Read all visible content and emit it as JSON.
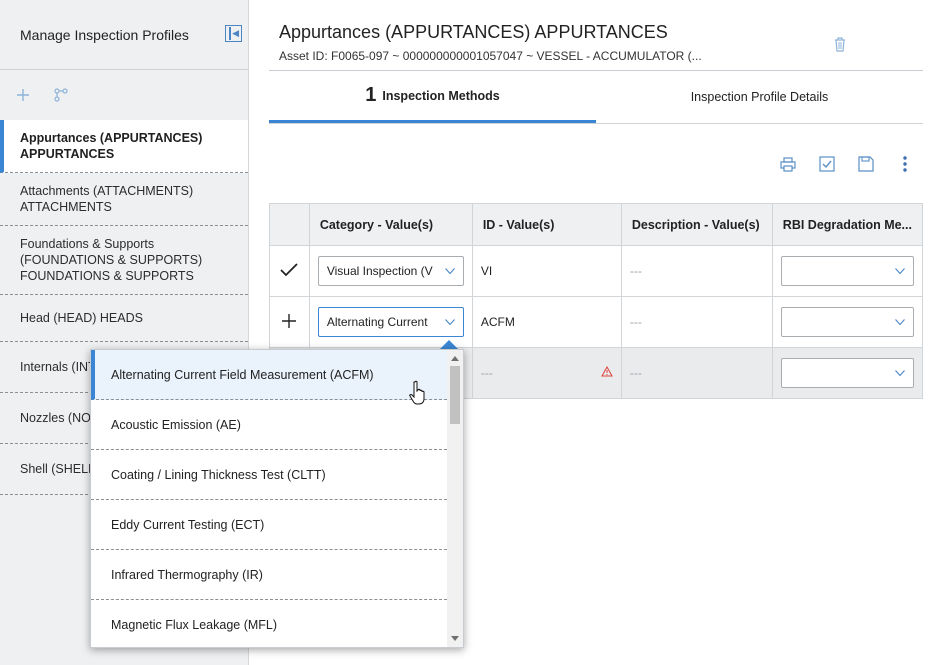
{
  "sidebar": {
    "title": "Manage Inspection Profiles",
    "items": [
      {
        "label": "Appurtances (APPURTANCES) APPURTANCES",
        "active": true
      },
      {
        "label": "Attachments (ATTACHMENTS) ATTACHMENTS"
      },
      {
        "label": "Foundations & Supports (FOUNDATIONS & SUPPORTS) FOUNDATIONS & SUPPORTS"
      },
      {
        "label": "Head (HEAD) HEADS"
      },
      {
        "label": "Internals (INT"
      },
      {
        "label": "Nozzles (NOZ"
      },
      {
        "label": "Shell (SHELL)"
      }
    ]
  },
  "header": {
    "title": "Appurtances (APPURTANCES) APPURTANCES",
    "asset_line": "Asset ID: F0065-097 ~ 000000000001057047 ~ VESSEL - ACCUMULATOR (..."
  },
  "tabs": [
    {
      "count": "1",
      "label": "Inspection Methods"
    },
    {
      "label": "Inspection Profile Details"
    }
  ],
  "grid": {
    "columns": [
      "Category - Value(s)",
      "ID - Value(s)",
      "Description - Value(s)",
      "RBI Degradation Me..."
    ],
    "rows": [
      {
        "category": "Visual Inspection (V",
        "id": "VI",
        "description": "---"
      },
      {
        "category": "Alternating Current",
        "id": "ACFM",
        "description": "---"
      },
      {
        "category": "",
        "id": "---",
        "description": "---"
      }
    ]
  },
  "dropdown": {
    "options": [
      "Alternating Current Field Measurement (ACFM)",
      "Acoustic Emission (AE)",
      "Coating / Lining Thickness Test (CLTT)",
      "Eddy Current Testing (ECT)",
      "Infrared Thermography (IR)",
      "Magnetic Flux Leakage (MFL)"
    ],
    "highlighted_index": 0
  },
  "colors": {
    "accent": "#3b86d4",
    "sidebar_bg": "#eef0f2",
    "warning": "#e0403a"
  }
}
